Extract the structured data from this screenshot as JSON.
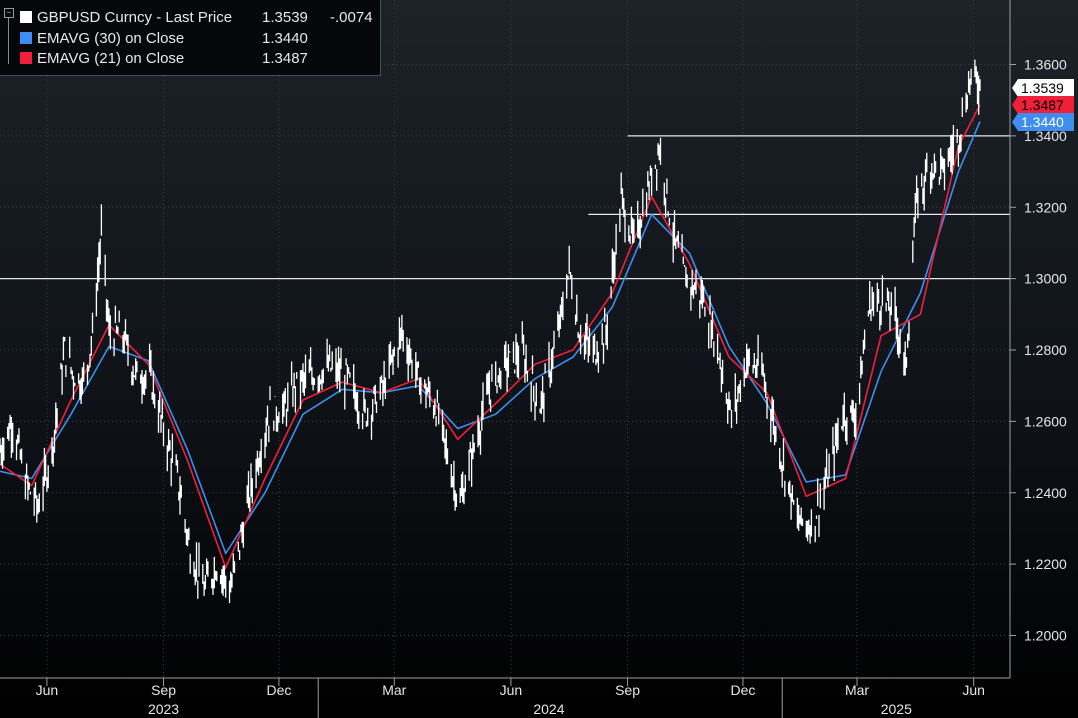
{
  "legend": {
    "items": [
      {
        "label": "GBPUSD Curncy - Last Price",
        "value": "1.3539",
        "change": "-.0074",
        "color": "#ffffff"
      },
      {
        "label": "EMAVG (30)  on Close",
        "value": "1.3440",
        "color": "#3d8ef0"
      },
      {
        "label": "EMAVG (21)  on Close",
        "value": "1.3487",
        "color": "#f0203a"
      }
    ]
  },
  "chart_data": {
    "type": "line",
    "x_tick_labels": [
      "Jun",
      "Sep",
      "Dec",
      "Mar",
      "Jun",
      "Sep",
      "Dec",
      "Mar",
      "Jun"
    ],
    "year_labels": [
      "2023",
      "2024",
      "2025"
    ],
    "y_tick_labels": [
      "1.3600",
      "1.3400",
      "1.3200",
      "1.3000",
      "1.2800",
      "1.2600",
      "1.2400",
      "1.2200",
      "1.2000"
    ],
    "y_ticks": [
      1.36,
      1.34,
      1.32,
      1.3,
      1.28,
      1.26,
      1.24,
      1.22,
      1.2
    ],
    "ylim": [
      1.19,
      1.372
    ],
    "x_range": [
      "2023-04-25",
      "2025-06-06"
    ],
    "grid": true,
    "series": [
      {
        "name": "GBPUSD Curncy - Last Price",
        "color": "#ffffff",
        "dates": [
          "2023-04-25",
          "2023-05-05",
          "2023-05-15",
          "2023-05-25",
          "2023-06-05",
          "2023-06-15",
          "2023-06-22",
          "2023-06-30",
          "2023-07-07",
          "2023-07-14",
          "2023-07-20",
          "2023-07-31",
          "2023-08-10",
          "2023-08-21",
          "2023-08-31",
          "2023-09-12",
          "2023-09-22",
          "2023-10-03",
          "2023-10-13",
          "2023-10-24",
          "2023-11-03",
          "2023-11-14",
          "2023-11-24",
          "2023-12-05",
          "2023-12-14",
          "2023-12-28",
          "2024-01-10",
          "2024-01-24",
          "2024-02-07",
          "2024-02-21",
          "2024-03-07",
          "2024-03-20",
          "2024-04-03",
          "2024-04-15",
          "2024-04-22",
          "2024-05-03",
          "2024-05-15",
          "2024-05-28",
          "2024-06-10",
          "2024-06-24",
          "2024-07-08",
          "2024-07-17",
          "2024-07-25",
          "2024-08-05",
          "2024-08-15",
          "2024-08-27",
          "2024-09-06",
          "2024-09-16",
          "2024-09-26",
          "2024-10-07",
          "2024-10-17",
          "2024-10-30",
          "2024-11-12",
          "2024-11-22",
          "2024-12-04",
          "2024-12-16",
          "2024-12-30",
          "2025-01-13",
          "2025-01-24",
          "2025-02-05",
          "2025-02-18",
          "2025-02-28",
          "2025-03-11",
          "2025-03-21",
          "2025-04-01",
          "2025-04-08",
          "2025-04-17",
          "2025-04-28",
          "2025-05-08",
          "2025-05-20",
          "2025-05-30",
          "2025-06-06"
        ],
        "values": [
          1.252,
          1.26,
          1.243,
          1.236,
          1.252,
          1.28,
          1.273,
          1.271,
          1.284,
          1.313,
          1.285,
          1.284,
          1.273,
          1.273,
          1.259,
          1.244,
          1.224,
          1.213,
          1.22,
          1.213,
          1.231,
          1.249,
          1.263,
          1.263,
          1.27,
          1.273,
          1.275,
          1.272,
          1.262,
          1.269,
          1.285,
          1.272,
          1.264,
          1.246,
          1.237,
          1.253,
          1.269,
          1.276,
          1.279,
          1.264,
          1.284,
          1.303,
          1.285,
          1.279,
          1.285,
          1.322,
          1.31,
          1.323,
          1.337,
          1.312,
          1.3,
          1.295,
          1.279,
          1.261,
          1.277,
          1.274,
          1.252,
          1.232,
          1.231,
          1.243,
          1.262,
          1.262,
          1.293,
          1.294,
          1.289,
          1.274,
          1.322,
          1.332,
          1.33,
          1.34,
          1.357,
          1.3539
        ]
      },
      {
        "name": "EMAVG (30)  on Close",
        "color": "#3d8ef0",
        "dates": [
          "2023-04-25",
          "2023-05-20",
          "2023-06-20",
          "2023-07-20",
          "2023-08-20",
          "2023-09-20",
          "2023-10-20",
          "2023-11-20",
          "2023-12-20",
          "2024-01-20",
          "2024-02-20",
          "2024-03-20",
          "2024-04-20",
          "2024-05-20",
          "2024-06-20",
          "2024-07-20",
          "2024-08-20",
          "2024-09-20",
          "2024-10-20",
          "2024-11-20",
          "2024-12-20",
          "2025-01-20",
          "2025-02-20",
          "2025-03-20",
          "2025-04-20",
          "2025-05-20",
          "2025-06-06"
        ],
        "values": [
          1.246,
          1.244,
          1.262,
          1.281,
          1.277,
          1.252,
          1.223,
          1.24,
          1.262,
          1.269,
          1.268,
          1.27,
          1.258,
          1.262,
          1.272,
          1.278,
          1.292,
          1.318,
          1.307,
          1.281,
          1.265,
          1.243,
          1.245,
          1.274,
          1.296,
          1.33,
          1.344
        ]
      },
      {
        "name": "EMAVG (21)  on Close",
        "color": "#f0203a",
        "dates": [
          "2023-04-25",
          "2023-05-20",
          "2023-06-20",
          "2023-07-20",
          "2023-08-20",
          "2023-09-20",
          "2023-10-20",
          "2023-11-20",
          "2023-12-20",
          "2024-01-20",
          "2024-02-20",
          "2024-03-20",
          "2024-04-20",
          "2024-05-20",
          "2024-06-20",
          "2024-07-20",
          "2024-08-20",
          "2024-09-20",
          "2024-10-20",
          "2024-11-20",
          "2024-12-20",
          "2025-01-20",
          "2025-02-20",
          "2025-03-20",
          "2025-04-20",
          "2025-05-20",
          "2025-06-06"
        ],
        "values": [
          1.248,
          1.242,
          1.266,
          1.287,
          1.276,
          1.249,
          1.219,
          1.244,
          1.266,
          1.271,
          1.268,
          1.272,
          1.255,
          1.265,
          1.276,
          1.28,
          1.296,
          1.323,
          1.304,
          1.278,
          1.268,
          1.239,
          1.244,
          1.284,
          1.29,
          1.337,
          1.3487
        ]
      }
    ],
    "horizontal_lines": [
      {
        "value": 1.3,
        "from": "2023-04-25"
      },
      {
        "value": 1.318,
        "from": "2024-08-01"
      },
      {
        "value": 1.34,
        "from": "2024-09-01"
      }
    ]
  }
}
